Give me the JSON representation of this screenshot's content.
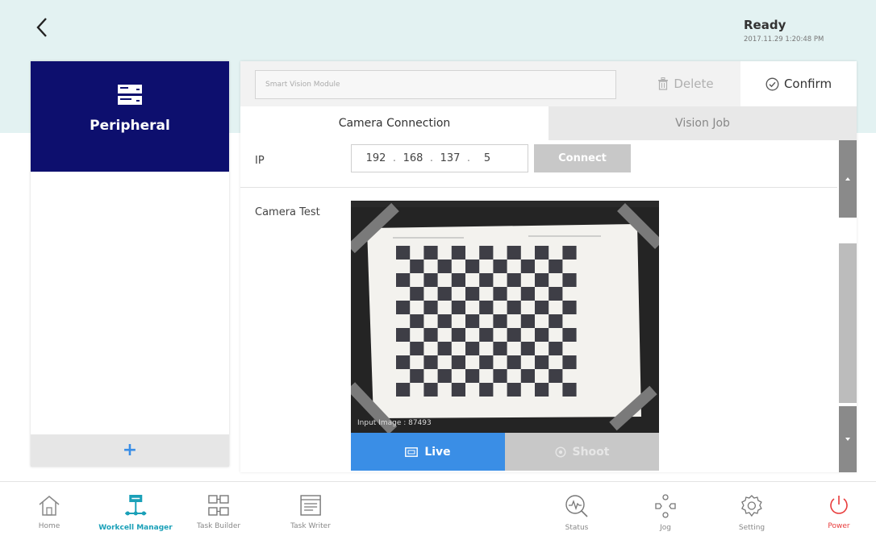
{
  "header": {
    "status": "Ready",
    "datetime": "2017.11.29 1:20:48 PM"
  },
  "sidebar": {
    "selected_label": "Peripheral",
    "add_label": "+"
  },
  "toolbar": {
    "name_value": "Smart Vision Module",
    "delete_label": "Delete",
    "confirm_label": "Confirm"
  },
  "tabs": [
    {
      "label": "Camera Connection",
      "active": true
    },
    {
      "label": "Vision Job",
      "active": false
    }
  ],
  "connection": {
    "ip_label": "IP",
    "ip": [
      "192",
      "168",
      "137",
      "5"
    ],
    "connect_label": "Connect"
  },
  "camera": {
    "test_label": "Camera Test",
    "overlay_text": "Input Image : 87493",
    "live_label": "Live",
    "shoot_label": "Shoot"
  },
  "nav": {
    "left": [
      {
        "label": "Home",
        "icon": "home-icon"
      },
      {
        "label": "Workcell Manager",
        "icon": "workcell-icon",
        "active": true
      },
      {
        "label": "Task Builder",
        "icon": "task-builder-icon"
      },
      {
        "label": "Task Writer",
        "icon": "task-writer-icon"
      }
    ],
    "right": [
      {
        "label": "Status",
        "icon": "status-icon"
      },
      {
        "label": "Jog",
        "icon": "jog-icon"
      },
      {
        "label": "Setting",
        "icon": "gear-icon"
      },
      {
        "label": "Power",
        "icon": "power-icon"
      }
    ]
  },
  "colors": {
    "header_bg": "#e3f2f2",
    "peripheral_bg": "#0d0f6e",
    "accent_blue": "#3a8ee6",
    "active_nav": "#1aa0b8",
    "power_red": "#e83a3a"
  }
}
